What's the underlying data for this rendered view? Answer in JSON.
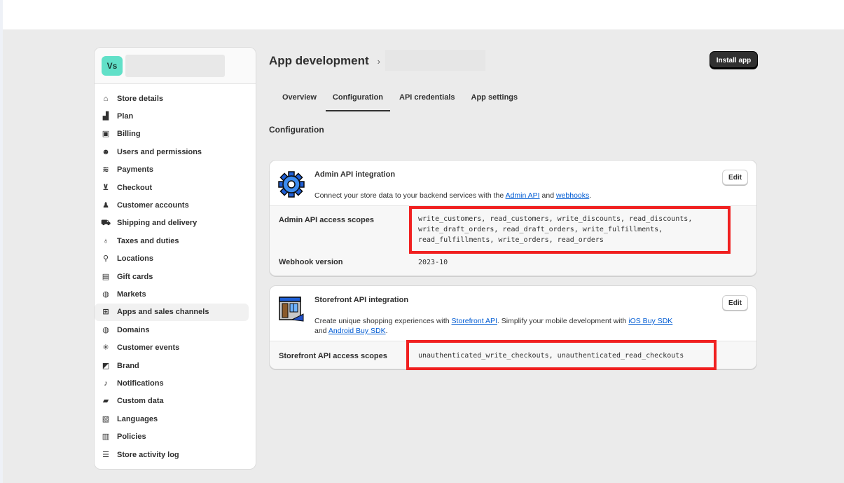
{
  "store": {
    "avatar_initials": "Vs"
  },
  "sidebar": {
    "items": [
      {
        "label": "Store details",
        "icon": "store-icon"
      },
      {
        "label": "Plan",
        "icon": "plan-icon"
      },
      {
        "label": "Billing",
        "icon": "billing-icon"
      },
      {
        "label": "Users and permissions",
        "icon": "users-icon"
      },
      {
        "label": "Payments",
        "icon": "payments-icon"
      },
      {
        "label": "Checkout",
        "icon": "cart-icon"
      },
      {
        "label": "Customer accounts",
        "icon": "person-icon"
      },
      {
        "label": "Shipping and delivery",
        "icon": "truck-icon"
      },
      {
        "label": "Taxes and duties",
        "icon": "taxes-icon"
      },
      {
        "label": "Locations",
        "icon": "location-icon"
      },
      {
        "label": "Gift cards",
        "icon": "gift-card-icon"
      },
      {
        "label": "Markets",
        "icon": "globe-icon"
      },
      {
        "label": "Apps and sales channels",
        "icon": "apps-icon"
      },
      {
        "label": "Domains",
        "icon": "globe-icon"
      },
      {
        "label": "Customer events",
        "icon": "events-icon"
      },
      {
        "label": "Brand",
        "icon": "brand-icon"
      },
      {
        "label": "Notifications",
        "icon": "bell-icon"
      },
      {
        "label": "Custom data",
        "icon": "custom-data-icon"
      },
      {
        "label": "Languages",
        "icon": "language-icon"
      },
      {
        "label": "Policies",
        "icon": "policies-icon"
      },
      {
        "label": "Store activity log",
        "icon": "list-icon"
      }
    ],
    "active_index": 12
  },
  "header": {
    "title": "App development",
    "chevron": "›",
    "install_label": "Install app"
  },
  "tabs": [
    {
      "label": "Overview"
    },
    {
      "label": "Configuration"
    },
    {
      "label": "API credentials"
    },
    {
      "label": "App settings"
    }
  ],
  "section_title": "Configuration",
  "admin_card": {
    "title": "Admin API integration",
    "desc_prefix": "Connect your store data to your backend services with the ",
    "link1": "Admin API",
    "desc_mid": " and ",
    "link2": "webhooks",
    "desc_suffix": ".",
    "edit_label": "Edit",
    "scopes_label": "Admin API access scopes",
    "scopes_line1": "write_customers, read_customers, write_discounts, read_discounts,",
    "scopes_line2": "write_draft_orders, read_draft_orders, write_fulfillments,",
    "scopes_line3": "read_fulfillments, write_orders, read_orders",
    "webhook_label": "Webhook version",
    "webhook_value": "2023-10"
  },
  "storefront_card": {
    "title": "Storefront API integration",
    "desc_prefix": "Create unique shopping experiences with ",
    "link1": "Storefront API",
    "desc_mid": ". Simplify your mobile development with ",
    "link2": "iOS Buy SDK",
    "desc_line2_prefix": "and ",
    "link3": "Android Buy SDK",
    "desc_suffix": ".",
    "edit_label": "Edit",
    "scopes_label": "Storefront API access scopes",
    "scopes_value": "unauthenticated_write_checkouts, unauthenticated_read_checkouts"
  },
  "colors": {
    "accent_link": "#005bd3",
    "highlight_red": "#f02020",
    "avatar_bg": "#61e0c8"
  }
}
